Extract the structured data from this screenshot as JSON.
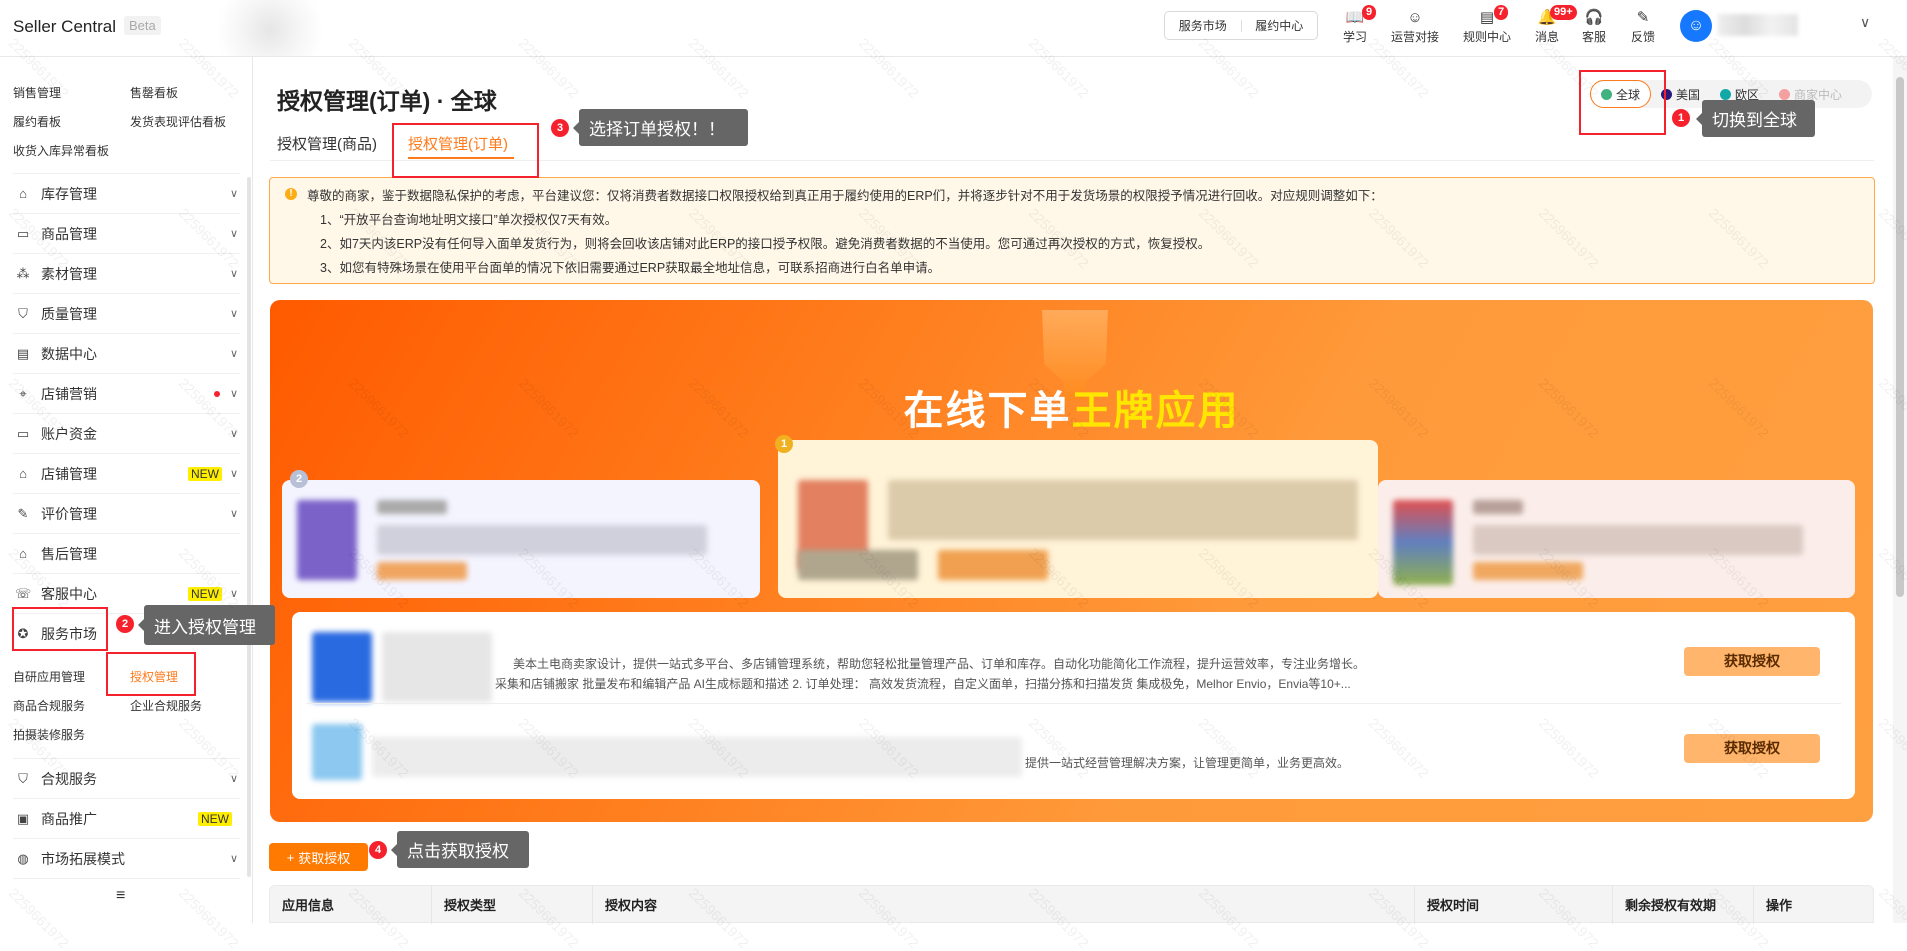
{
  "header": {
    "logo": "Seller Central",
    "beta": "Beta",
    "links": [
      "服务市场",
      "履约中心"
    ],
    "icons": [
      {
        "name": "learn",
        "label": "学习",
        "glyph": "📖",
        "badge": "9"
      },
      {
        "name": "ops",
        "label": "运营对接",
        "glyph": "☺"
      },
      {
        "name": "rules",
        "label": "规则中心",
        "glyph": "▤",
        "badge": "7"
      },
      {
        "name": "messages",
        "label": "消息",
        "glyph": "🔔",
        "badge": "99+"
      },
      {
        "name": "service",
        "label": "客服",
        "glyph": "🎧"
      },
      {
        "name": "feedback",
        "label": "反馈",
        "glyph": "✎"
      }
    ]
  },
  "sidebar": {
    "quick": [
      "销售管理",
      "售罄看板",
      "履约看板",
      "发货表现评估看板",
      "收货入库异常看板"
    ],
    "items": [
      {
        "label": "库存管理",
        "icon": "⌂"
      },
      {
        "label": "商品管理",
        "icon": "▭"
      },
      {
        "label": "素材管理",
        "icon": "⁂"
      },
      {
        "label": "质量管理",
        "icon": "⛉"
      },
      {
        "label": "数据中心",
        "icon": "▤"
      },
      {
        "label": "店铺营销",
        "icon": "⌖"
      },
      {
        "label": "账户资金",
        "icon": "▭"
      },
      {
        "label": "店铺管理",
        "icon": "⌂",
        "badge": "NEW"
      },
      {
        "label": "评价管理",
        "icon": "✎"
      },
      {
        "label": "售后管理",
        "icon": "⌂"
      },
      {
        "label": "客服中心",
        "icon": "☏",
        "badge": "NEW"
      },
      {
        "label": "服务市场",
        "icon": "✪"
      }
    ],
    "sub": [
      "自研应用管理",
      "授权管理",
      "商品合规服务",
      "企业合规服务",
      "拍摄装修服务"
    ],
    "bottom_items": [
      {
        "label": "合规服务",
        "icon": "⛉"
      },
      {
        "label": "商品推广",
        "icon": "▣",
        "badge": "NEW"
      },
      {
        "label": "市场拓展模式",
        "icon": "◍"
      }
    ],
    "collapse_icon": "≡"
  },
  "page": {
    "title": "授权管理(订单) · 全球",
    "tabs": [
      "授权管理(商品)",
      "授权管理(订单)"
    ],
    "regions": [
      {
        "label": "全球",
        "color": "#3fb27f"
      },
      {
        "label": "美国",
        "color": "#2a1a7a"
      },
      {
        "label": "欧区",
        "color": "#13a8a8"
      },
      {
        "label": "商家中心",
        "color": "#f5a0a0"
      }
    ]
  },
  "notice": {
    "lines": [
      "尊敬的商家，鉴于数据隐私保护的考虑，平台建议您：仅将消费者数据接口权限授权给到真正用于履约使用的ERP们，并将逐步针对不用于发货场景的权限授予情况进行回收。对应规则调整如下：",
      "1、“开放平台查询地址明文接口”单次授权仅7天有效。",
      "2、如7天内该ERP没有任何导入面单发货行为，则将会回收该店铺对此ERP的接口授予权限。避免消费者数据的不当使用。您可通过再次授权的方式，恢复授权。",
      "3、如您有特殊场景在使用平台面单的情况下依旧需要通过ERP获取最全地址信息，可联系招商进行白名单申请。"
    ]
  },
  "banner": {
    "title_a": "在线下单",
    "title_b": "王牌应用",
    "rank_1": "1",
    "rank_2": "2",
    "apps": [
      {
        "desc1": "美本土电商卖家设计，提供一站式多平台、多店铺管理系统，帮助您轻松批量管理产品、订单和库存。自动化功能简化工作流程，提升运营效率，专注业务增长。",
        "desc2": "采集和店铺搬家 批量发布和编辑产品 AI生成标题和描述 2. 订单处理： 高效发货流程，自定义面单，扫描分拣和扫描发货 集成极免，Melhor Envio，Envia等10+...",
        "button": "获取授权"
      },
      {
        "desc1": "提供一站式经营管理解决方案，让管理更简单，业务更高效。",
        "button": "获取授权"
      }
    ]
  },
  "actions": {
    "add_auth": "获取授权"
  },
  "table": {
    "columns": [
      "应用信息",
      "授权类型",
      "授权内容",
      "授权时间",
      "剩余授权有效期",
      "操作"
    ]
  },
  "annotations": [
    {
      "num": "1",
      "text": "切换到全球"
    },
    {
      "num": "2",
      "text": "进入授权管理"
    },
    {
      "num": "3",
      "text": "选择订单授权！！"
    },
    {
      "num": "4",
      "text": "点击获取授权"
    }
  ],
  "watermark": "2259661972",
  "colors": {
    "accent": "#ff7a1a",
    "annotation": "#f5222d"
  }
}
